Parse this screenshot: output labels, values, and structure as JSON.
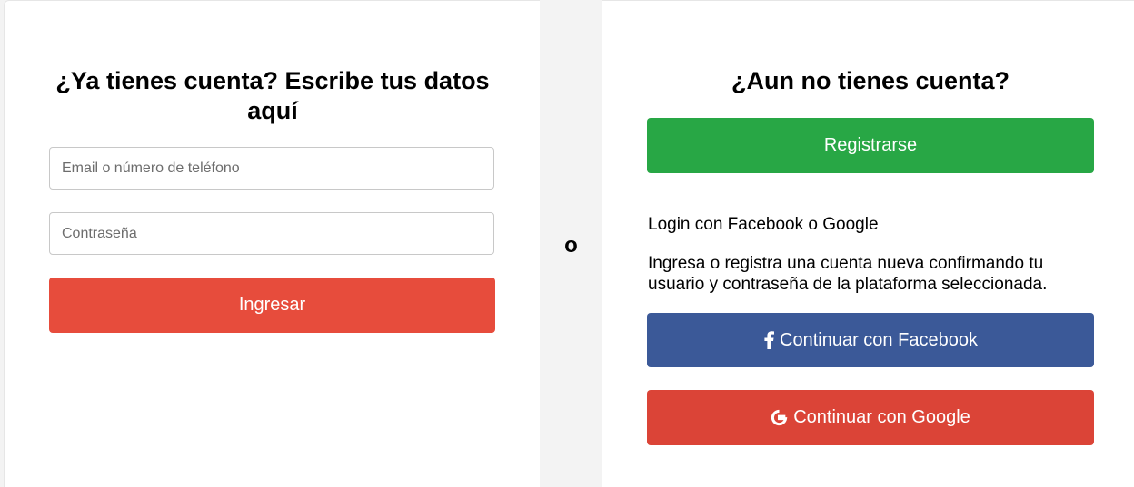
{
  "login": {
    "heading": "¿Ya tienes cuenta? Escribe tus datos aquí",
    "email_placeholder": "Email o número de teléfono",
    "password_placeholder": "Contraseña",
    "submit_label": "Ingresar"
  },
  "separator": {
    "text": "o"
  },
  "signup": {
    "heading": "¿Aun no tienes cuenta?",
    "register_label": "Registrarse",
    "social_title": "Login con Facebook o Google",
    "social_description": "Ingresa o registra una cuenta nueva confirmando tu usuario y contraseña de la plataforma seleccionada.",
    "facebook_label": "Continuar con Facebook",
    "google_label": "Continuar con Google"
  },
  "colors": {
    "login_button": "#e74c3c",
    "register_button": "#28a745",
    "facebook_button": "#3b5998",
    "google_button": "#db4437"
  },
  "icons": {
    "facebook": "facebook-icon",
    "google": "google-icon"
  }
}
